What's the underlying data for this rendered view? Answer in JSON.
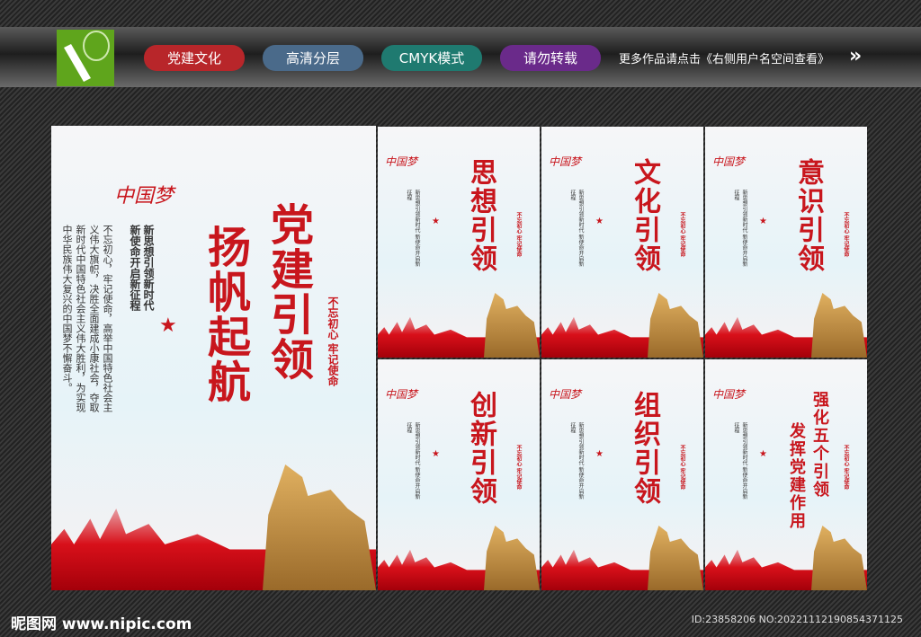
{
  "header": {
    "tags": [
      {
        "label": "党建文化",
        "color": "#b8262a"
      },
      {
        "label": "高清分层",
        "color": "#4a6a8a"
      },
      {
        "label": "CMYK模式",
        "color": "#1f7a70"
      },
      {
        "label": "请勿转载",
        "color": "#6a2a8a"
      }
    ],
    "more_text": "更多作品请点击《右侧用户名空间查看》",
    "arrow": "»"
  },
  "main_poster": {
    "logo_text": "中国梦",
    "title_1": "党建引领",
    "title_2": "扬帆起航",
    "subtitle_1": "新思想引领新时代",
    "subtitle_2": "新使命开启新征程",
    "body": "不忘初心，牢记使命，高举中国特色社会主义伟大旗帜，决胜全面建成小康社会，夺取新时代中国特色社会主义伟大胜利，为实现中华民族伟大复兴的中国梦不懈奋斗。",
    "slogan": "不忘初心 牢记使命"
  },
  "small_posters": [
    {
      "title": "思想引领"
    },
    {
      "title": "文化引领"
    },
    {
      "title": "意识引领"
    },
    {
      "title": "创新引领"
    },
    {
      "title": "组织引领"
    },
    {
      "title": "强化五个引领",
      "title2": "发挥党建作用"
    }
  ],
  "small_body": "新思想引领新时代 新使命开启新征程",
  "footer": {
    "site": "昵图网 www.nipic.com",
    "id": "ID:23858206 NO:20221112190854371125"
  }
}
